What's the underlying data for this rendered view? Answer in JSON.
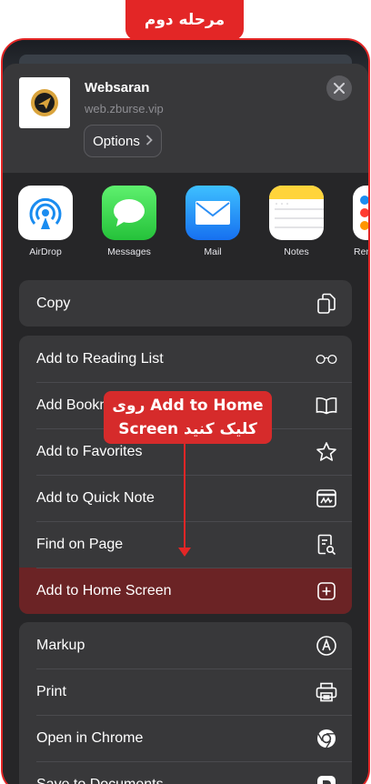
{
  "step_tab": "مرحله دوم",
  "site": {
    "title": "Websaran",
    "url": "web.zburse.vip",
    "options_label": "Options"
  },
  "apps": [
    {
      "label": "AirDrop",
      "icon": "airdrop-icon"
    },
    {
      "label": "Messages",
      "icon": "messages-icon"
    },
    {
      "label": "Mail",
      "icon": "mail-icon"
    },
    {
      "label": "Notes",
      "icon": "notes-icon"
    },
    {
      "label": "Rem",
      "icon": "reminders-icon"
    }
  ],
  "actions": {
    "group1": [
      {
        "label": "Copy",
        "icon": "copy-icon"
      }
    ],
    "group2": [
      {
        "label": "Add to Reading List",
        "icon": "glasses-icon"
      },
      {
        "label": "Add Bookmark",
        "icon": "book-icon"
      },
      {
        "label": "Add to Favorites",
        "icon": "star-icon"
      },
      {
        "label": "Add to Quick Note",
        "icon": "quick-note-icon"
      },
      {
        "label": "Find on Page",
        "icon": "find-icon"
      },
      {
        "label": "Add to Home Screen",
        "icon": "add-square-icon"
      }
    ],
    "group3": [
      {
        "label": "Markup",
        "icon": "markup-icon"
      },
      {
        "label": "Print",
        "icon": "print-icon"
      },
      {
        "label": "Open in Chrome",
        "icon": "chrome-icon"
      },
      {
        "label": "Save to Documents",
        "icon": "documents-icon"
      }
    ]
  },
  "callout": {
    "line1": "روی Add to Home",
    "line2": "Screen کلیک کنید"
  },
  "colors": {
    "accent": "#e32626",
    "highlight": "#6b2325",
    "sheet": "#38383a"
  }
}
